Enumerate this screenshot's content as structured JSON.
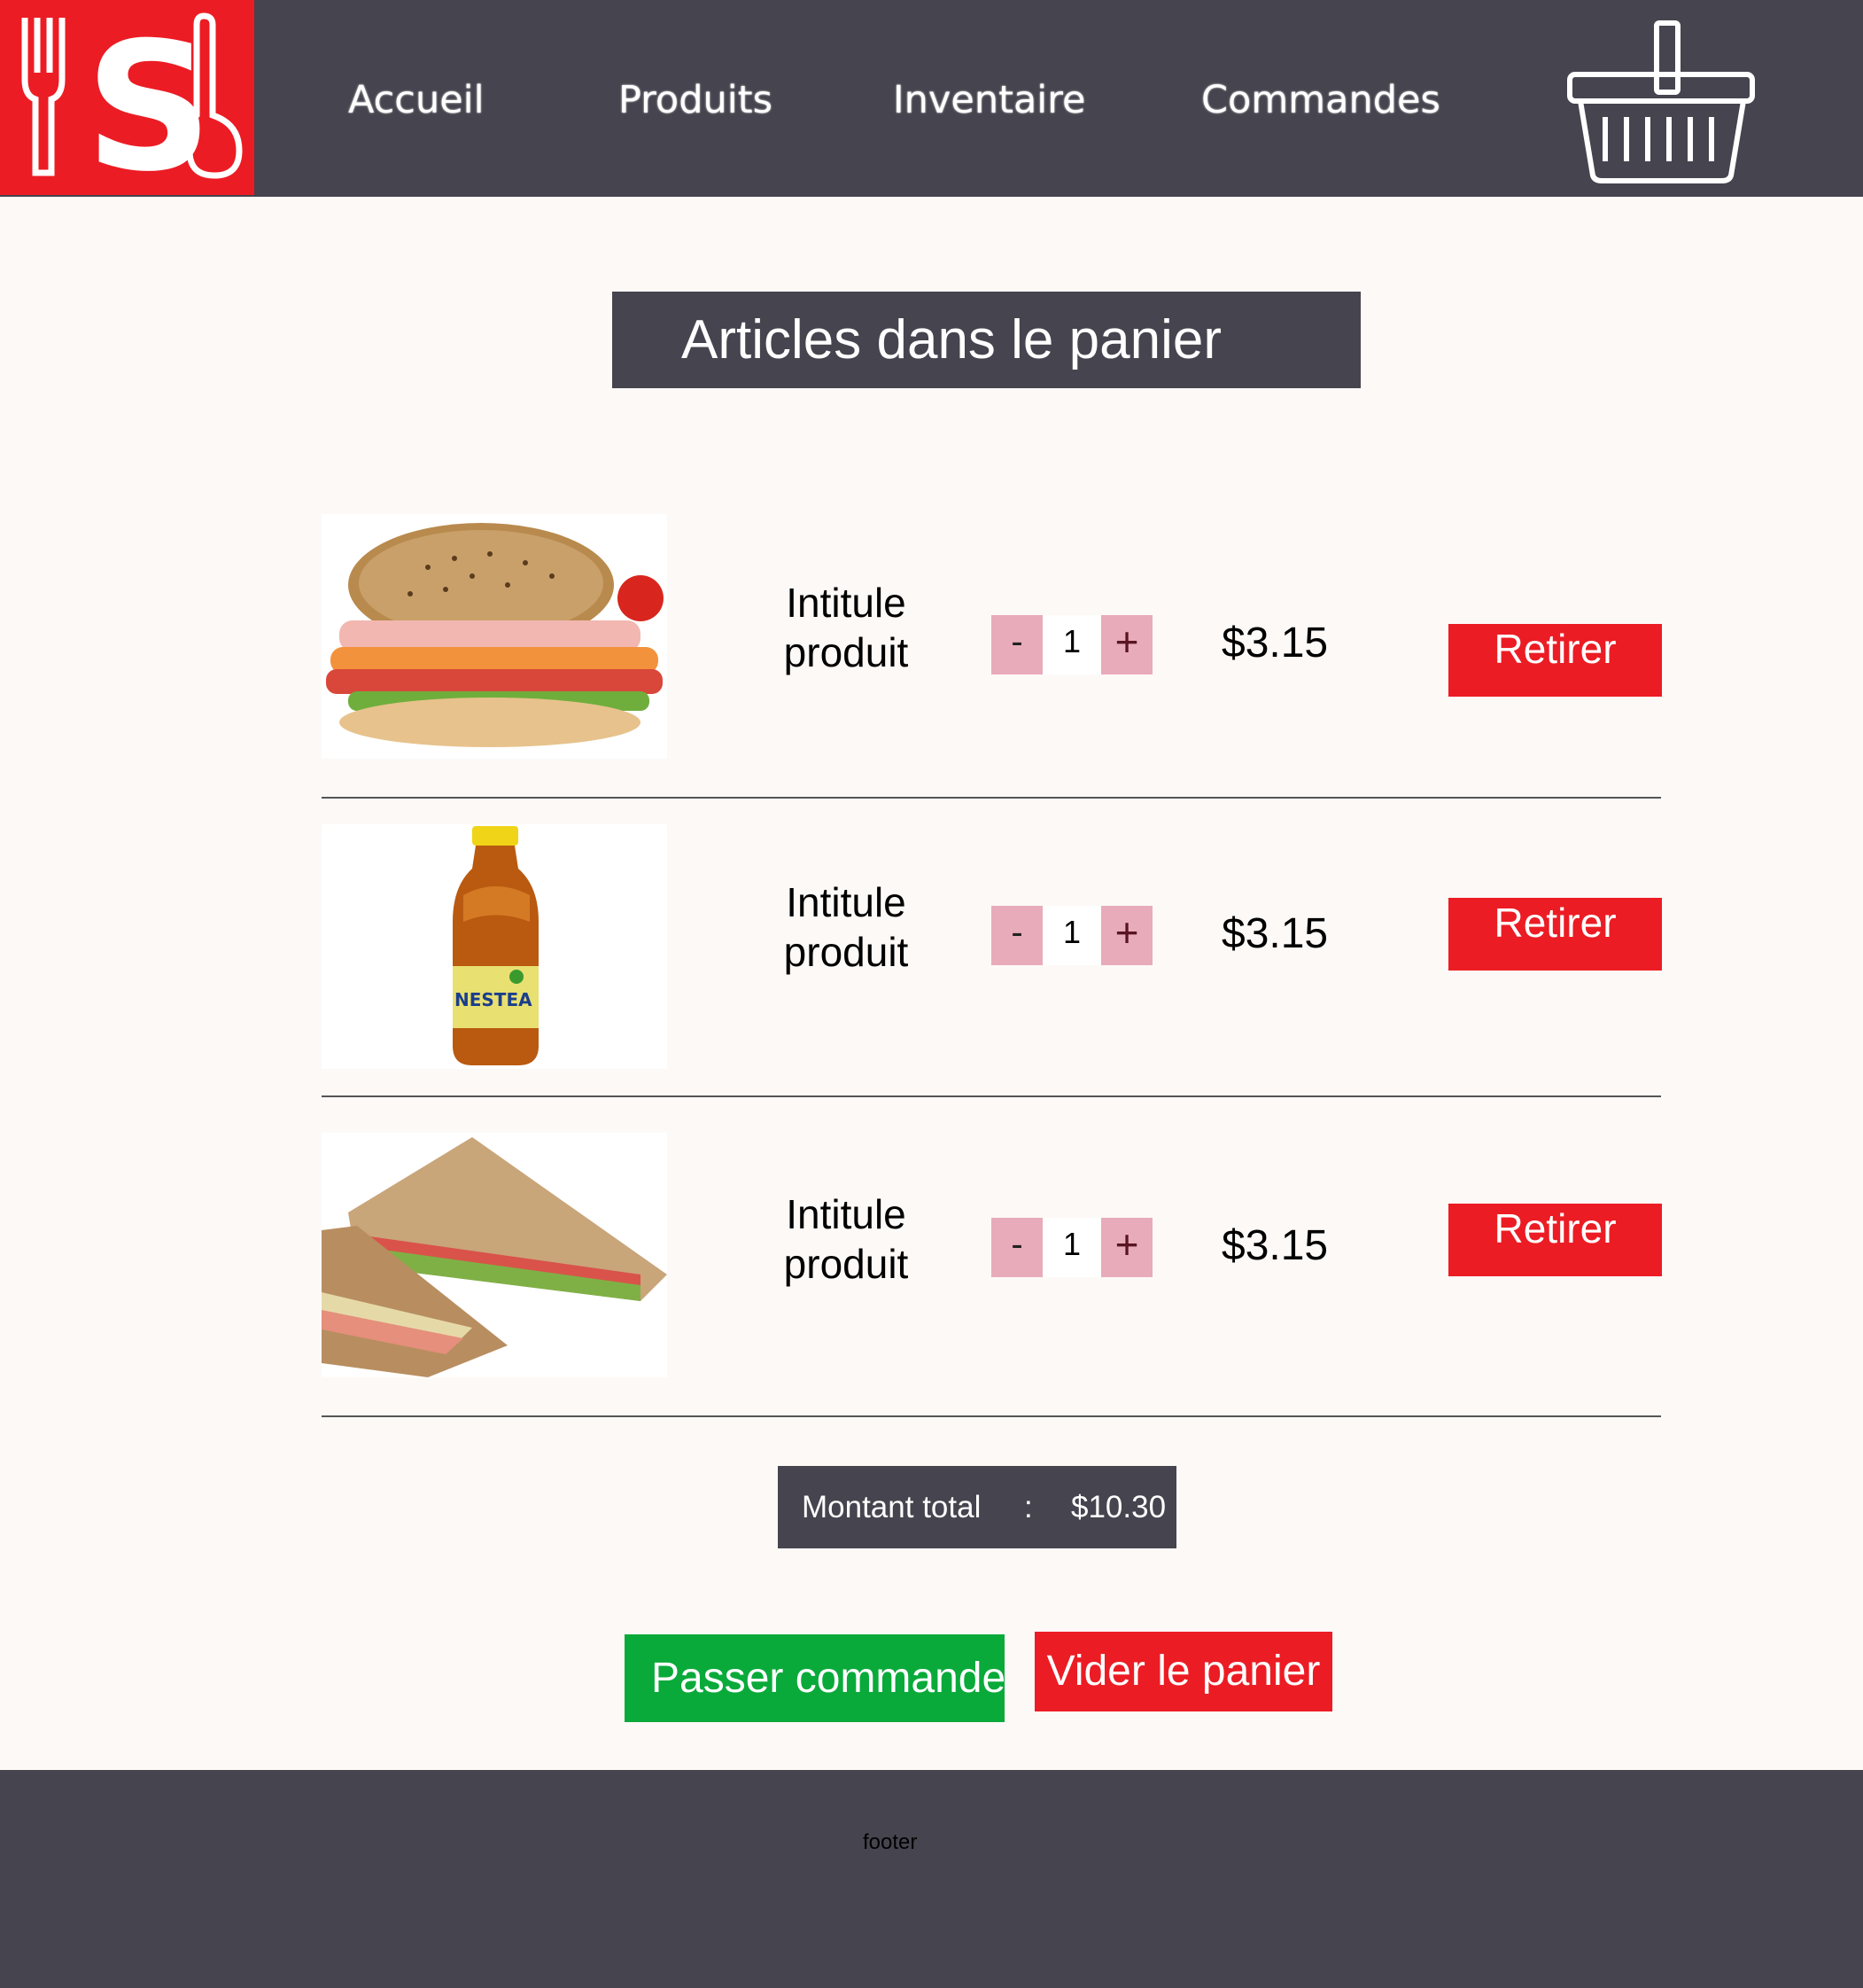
{
  "header": {
    "logo_icon": "fork-s-spoon-logo",
    "nav": [
      {
        "label": "Accueil"
      },
      {
        "label": "Produits"
      },
      {
        "label": "Inventaire"
      },
      {
        "label": "Commandes"
      }
    ],
    "cart_icon": "basket-icon"
  },
  "cart": {
    "title": "Articles dans le panier",
    "items": [
      {
        "image": "sandwich-ham-tomato",
        "title": "Intitule produit",
        "minus": "-",
        "qty": "1",
        "plus": "+",
        "price": "$3.15",
        "remove": "Retirer"
      },
      {
        "image": "nestea-bottle",
        "title": "Intitule produit",
        "minus": "-",
        "qty": "1",
        "plus": "+",
        "price": "$3.15",
        "remove": "Retirer"
      },
      {
        "image": "sandwich-triangle",
        "title": "Intitule produit",
        "minus": "-",
        "qty": "1",
        "plus": "+",
        "price": "$3.15",
        "remove": "Retirer"
      }
    ],
    "total_label": "Montant total",
    "total_sep": ":",
    "total_value": "$10.30",
    "order_button": "Passer commande",
    "clear_button": "Vider le panier"
  },
  "footer": {
    "text": "footer"
  },
  "colors": {
    "header_bg": "#46444e",
    "accent_red": "#ec1c24",
    "green": "#0aaa3a",
    "stepper_pink": "#e8abba"
  }
}
